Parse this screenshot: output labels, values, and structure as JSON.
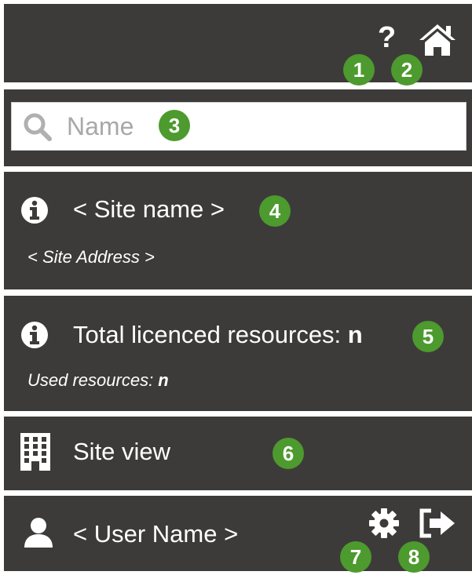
{
  "header": {
    "help_marker": "1",
    "home_marker": "2"
  },
  "search": {
    "placeholder": "Name",
    "marker": "3"
  },
  "site": {
    "name": "< Site name >",
    "address": "< Site Address >",
    "marker": "4"
  },
  "resources": {
    "total_label": "Total licenced resources: ",
    "total_value": "n",
    "used_label": "Used resources: ",
    "used_value": "n",
    "marker": "5"
  },
  "site_view": {
    "label": "Site view",
    "marker": "6"
  },
  "user": {
    "name": "< User Name >",
    "settings_marker": "7",
    "logout_marker": "8"
  },
  "colors": {
    "panel_bg": "#3d3b3a",
    "marker_green": "#4d9a2e",
    "text": "#ffffff"
  },
  "icons": [
    "help-icon",
    "home-icon",
    "search-icon",
    "info-icon",
    "building-icon",
    "user-icon",
    "gear-icon",
    "logout-icon"
  ]
}
